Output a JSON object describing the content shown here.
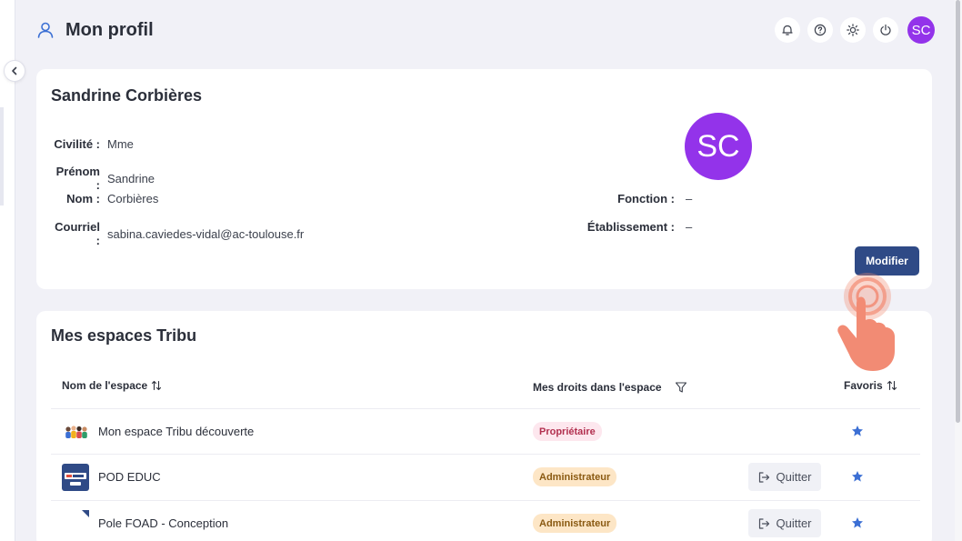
{
  "header": {
    "title": "Mon profil",
    "avatar_initials": "SC",
    "icons": [
      "bell-icon",
      "help-icon",
      "sun-icon",
      "power-icon"
    ]
  },
  "profile": {
    "name": "Sandrine Corbières",
    "avatar_initials": "SC",
    "fields": {
      "civilite": {
        "label": "Civilité :",
        "value": "Mme"
      },
      "prenom": {
        "label": "Prénom :",
        "value": "Sandrine"
      },
      "nom": {
        "label": "Nom :",
        "value": "Corbières"
      },
      "courriel": {
        "label": "Courriel :",
        "value": "sabina.caviedes-vidal@ac-toulouse.fr"
      },
      "fonction": {
        "label": "Fonction :",
        "value": "–"
      },
      "etablissement": {
        "label": "Établissement :",
        "value": "–"
      }
    },
    "modify_label": "Modifier"
  },
  "spaces": {
    "title": "Mes espaces Tribu",
    "columns": {
      "name": "Nom de l'espace",
      "rights": "Mes droits dans l'espace",
      "favorites": "Favoris"
    },
    "rows": [
      {
        "name": "Mon espace Tribu découverte",
        "role": "Propriétaire"
      },
      {
        "name": "POD EDUC",
        "role": "Administrateur",
        "quit": "Quitter"
      },
      {
        "name": "Pole FOAD - Conception",
        "role": "Administrateur",
        "quit": "Quitter"
      }
    ]
  },
  "colors": {
    "accent": "#2f4a86",
    "avatar": "#9333ea",
    "favorite_star": "#3b6fd4",
    "owner_badge_bg": "#fde7ee",
    "admin_badge_bg": "#fde6c6",
    "click_hint": "#f28b74"
  }
}
